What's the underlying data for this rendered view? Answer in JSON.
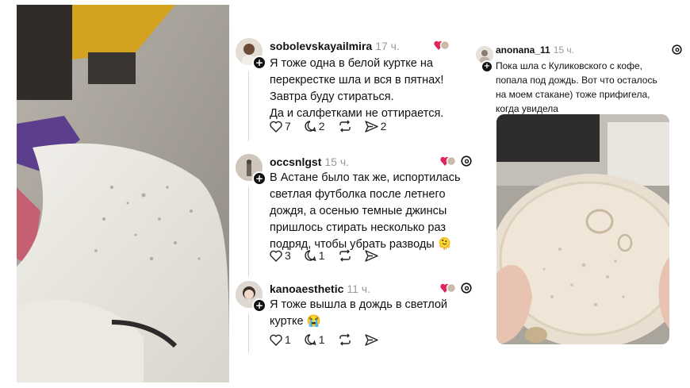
{
  "left_photo": {
    "description_icon": "jacket-photo"
  },
  "posts": [
    {
      "username": "sobolevskayailmira",
      "time": "17 ч.",
      "text_lines": [
        "Я тоже одна в белой куртке на",
        "перекрестке шла и вся в пятнах!",
        "Завтра буду стираться.",
        "Да и салфетками не оттирается."
      ],
      "likes": "7",
      "replies": "2",
      "reposts": "",
      "shares": "2"
    },
    {
      "username": "occsnlgst",
      "time": "15 ч.",
      "text_lines": [
        "В Астане было так же, испортилась",
        "светлая футболка после летнего",
        "дождя, а осенью темные джинсы",
        "пришлось стирать несколько раз",
        "подряд, чтобы убрать разводы 🫠"
      ],
      "likes": "3",
      "replies": "1",
      "reposts": "",
      "shares": ""
    },
    {
      "username": "kanoaesthetic",
      "time": "11 ч.",
      "text_lines": [
        "Я тоже вышла в дождь в светлой",
        "куртке 😭"
      ],
      "likes": "1",
      "replies": "1",
      "reposts": "",
      "shares": ""
    }
  ],
  "right_post": {
    "username": "anonana_11",
    "time": "15 ч.",
    "text_lines": [
      "Пока шла с Куликовского с кофе,",
      "попала под дождь. Вот что осталось",
      "на моем стакане) тоже прифигела,",
      "когда увидела"
    ]
  },
  "icons": {
    "like": "heart-icon",
    "reply": "comment-icon",
    "repost": "repost-icon",
    "share": "send-icon",
    "threads": "threads-logo-icon",
    "liked_by": "liked-by-avatar-icon"
  },
  "colors": {
    "accent_heart": "#e0245e",
    "muted": "#9a9a9a"
  }
}
